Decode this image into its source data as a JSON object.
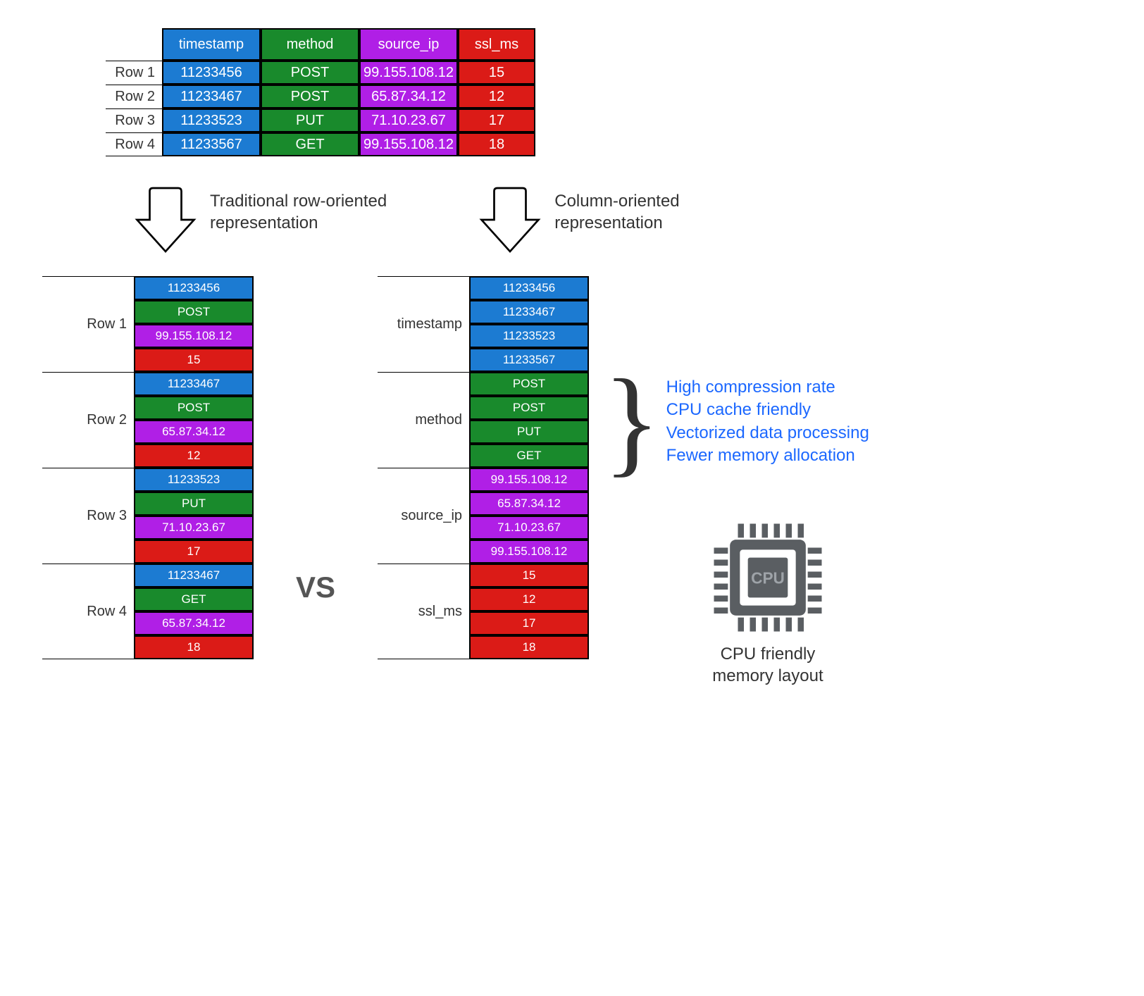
{
  "columns": [
    "timestamp",
    "method",
    "source_ip",
    "ssl_ms"
  ],
  "row_labels": [
    "Row 1",
    "Row 2",
    "Row 3",
    "Row 4"
  ],
  "rows": [
    {
      "timestamp": "11233456",
      "method": "POST",
      "source_ip": "99.155.108.12",
      "ssl_ms": "15"
    },
    {
      "timestamp": "11233467",
      "method": "POST",
      "source_ip": "65.87.34.12",
      "ssl_ms": "12"
    },
    {
      "timestamp": "11233523",
      "method": "PUT",
      "source_ip": "71.10.23.67",
      "ssl_ms": "17"
    },
    {
      "timestamp": "11233567",
      "method": "GET",
      "source_ip": "99.155.108.12",
      "ssl_ms": "18"
    }
  ],
  "row_oriented": [
    {
      "label": "Row 1",
      "cells": [
        {
          "c": "blue",
          "v": "11233456"
        },
        {
          "c": "green",
          "v": "POST"
        },
        {
          "c": "purple",
          "v": "99.155.108.12"
        },
        {
          "c": "red",
          "v": "15"
        }
      ]
    },
    {
      "label": "Row 2",
      "cells": [
        {
          "c": "blue",
          "v": "11233467"
        },
        {
          "c": "green",
          "v": "POST"
        },
        {
          "c": "purple",
          "v": "65.87.34.12"
        },
        {
          "c": "red",
          "v": "12"
        }
      ]
    },
    {
      "label": "Row 3",
      "cells": [
        {
          "c": "blue",
          "v": "11233523"
        },
        {
          "c": "green",
          "v": "PUT"
        },
        {
          "c": "purple",
          "v": "71.10.23.67"
        },
        {
          "c": "red",
          "v": "17"
        }
      ]
    },
    {
      "label": "Row 4",
      "cells": [
        {
          "c": "blue",
          "v": "11233467"
        },
        {
          "c": "green",
          "v": "GET"
        },
        {
          "c": "purple",
          "v": "65.87.34.12"
        },
        {
          "c": "red",
          "v": "18"
        }
      ]
    }
  ],
  "col_oriented": [
    {
      "label": "timestamp",
      "color": "blue",
      "cells": [
        "11233456",
        "11233467",
        "11233523",
        "11233567"
      ]
    },
    {
      "label": "method",
      "color": "green",
      "cells": [
        "POST",
        "POST",
        "PUT",
        "GET"
      ]
    },
    {
      "label": "source_ip",
      "color": "purple",
      "cells": [
        "99.155.108.12",
        "65.87.34.12",
        "71.10.23.67",
        "99.155.108.12"
      ]
    },
    {
      "label": "ssl_ms",
      "color": "red",
      "cells": [
        "15",
        "12",
        "17",
        "18"
      ]
    }
  ],
  "arrow_left": "Traditional row-oriented\nrepresentation",
  "arrow_right": "Column-oriented\nrepresentation",
  "vs": "VS",
  "benefits": [
    "High compression rate",
    "CPU cache friendly",
    "Vectorized data processing",
    "Fewer memory allocation"
  ],
  "cpu_label": "CPU",
  "cpu_caption": "CPU friendly\nmemory layout"
}
